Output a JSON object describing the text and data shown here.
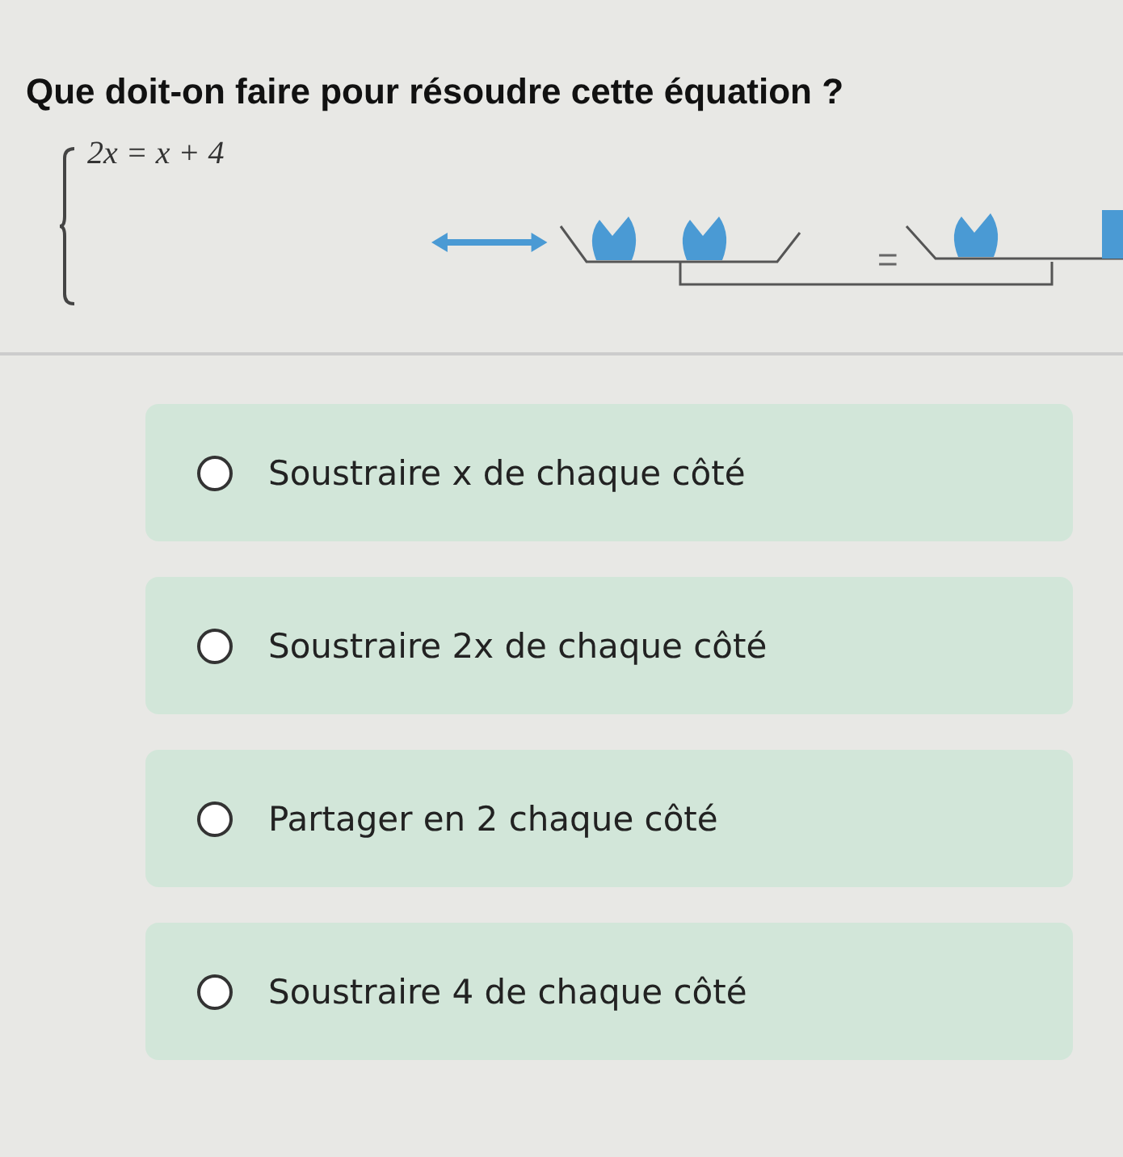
{
  "question": "Que doit-on faire pour résoudre cette équation ?",
  "equation": "2x = x + 4",
  "balance": {
    "equals": "="
  },
  "options": [
    {
      "label": "Soustraire x de chaque côté",
      "selected": false
    },
    {
      "label": "Soustraire 2x de chaque côté",
      "selected": false
    },
    {
      "label": "Partager en 2 chaque côté",
      "selected": false
    },
    {
      "label": "Soustraire 4 de chaque côté",
      "selected": false
    }
  ]
}
